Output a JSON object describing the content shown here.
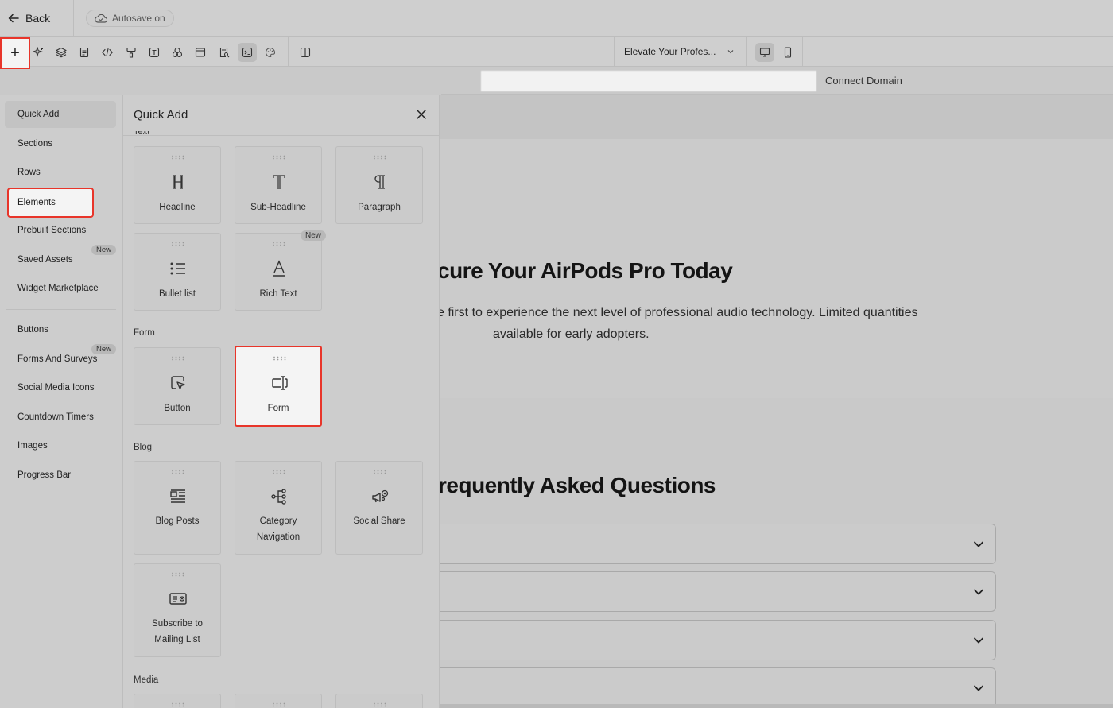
{
  "topbar": {
    "back_label": "Back",
    "autosave_label": "Autosave on"
  },
  "toolbar": {
    "add_label": "+",
    "page_select_value": "Elevate Your Profes...",
    "icons": [
      "sparkle-icon",
      "layers-icon",
      "page-icon",
      "code-icon",
      "paint-roller-icon",
      "text-box-icon",
      "shapes-icon",
      "window-icon",
      "search-doc-icon",
      "terminal-icon",
      "palette-icon",
      "columns-icon",
      "desktop-icon",
      "mobile-icon"
    ]
  },
  "url_bar": {
    "connect_domain_label": "Connect Domain"
  },
  "left_nav": {
    "items": [
      {
        "label": "Quick Add"
      },
      {
        "label": "Sections"
      },
      {
        "label": "Rows"
      },
      {
        "label": "Elements"
      },
      {
        "label": "Prebuilt Sections"
      },
      {
        "label": "Saved Assets",
        "badge": "New"
      },
      {
        "label": "Widget Marketplace"
      },
      {
        "label": "Buttons"
      },
      {
        "label": "Forms And Surveys",
        "badge": "New"
      },
      {
        "label": "Social Media Icons"
      },
      {
        "label": "Countdown Timers"
      },
      {
        "label": "Images"
      },
      {
        "label": "Progress Bar"
      }
    ]
  },
  "panel": {
    "title": "Quick Add",
    "partial_section_label": "Text",
    "sections": {
      "form": "Form",
      "blog": "Blog",
      "media": "Media"
    },
    "tiles": {
      "headline": "Headline",
      "sub_headline": "Sub-Headline",
      "paragraph": "Paragraph",
      "bullet_list": "Bullet list",
      "rich_text": "Rich Text",
      "rich_text_badge": "New",
      "button": "Button",
      "form": "Form",
      "blog_posts": "Blog Posts",
      "category_navigation_line1": "Category",
      "category_navigation_line2": "Navigation",
      "social_share": "Social Share",
      "subscribe_line1": "Subscribe to",
      "subscribe_line2": "Mailing List"
    }
  },
  "canvas": {
    "hero_title": "cure Your AirPods Pro Today",
    "hero_text_line1": "e first to experience the next level of professional audio technology. Limited quantities",
    "hero_text_line2": "available for early adopters.",
    "faq_title": "requently Asked Questions"
  },
  "colors": {
    "highlight": "#e8352a",
    "overlay_gray": "#cdcdcd"
  }
}
